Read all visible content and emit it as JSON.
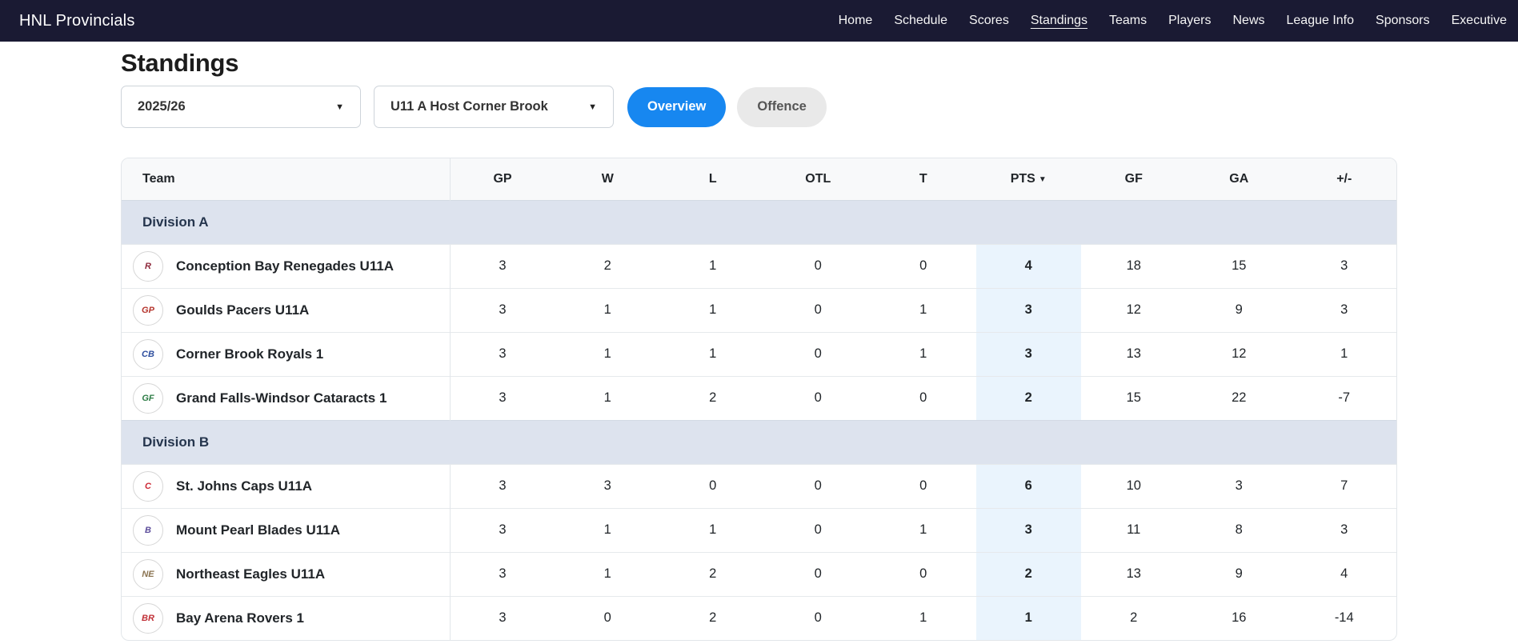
{
  "brand": "HNL Provincials",
  "nav": {
    "items": [
      {
        "label": "Home",
        "active": false
      },
      {
        "label": "Schedule",
        "active": false
      },
      {
        "label": "Scores",
        "active": false
      },
      {
        "label": "Standings",
        "active": true
      },
      {
        "label": "Teams",
        "active": false
      },
      {
        "label": "Players",
        "active": false
      },
      {
        "label": "News",
        "active": false
      },
      {
        "label": "League Info",
        "active": false
      },
      {
        "label": "Sponsors",
        "active": false
      },
      {
        "label": "Executive",
        "active": false
      }
    ]
  },
  "page_title": "Standings",
  "filters": {
    "season_value": "2025/26",
    "group_value": "U11 A Host Corner Brook"
  },
  "view_tabs": {
    "overview": "Overview",
    "offence": "Offence"
  },
  "colors": {
    "nav_bg": "#1a1a33",
    "primary": "#1787f0",
    "pts_bg": "#eaf4fd",
    "division_bg": "#dde3ee",
    "header_bg": "#f8f9fa"
  },
  "table": {
    "columns": [
      "Team",
      "GP",
      "W",
      "L",
      "OTL",
      "T",
      "PTS",
      "GF",
      "GA",
      "+/-"
    ],
    "sorted_by": "PTS",
    "sort_indicator": "▼",
    "sections": [
      {
        "name": "Division A",
        "rows": [
          {
            "team": "Conception Bay Renegades U11A",
            "logo": {
              "initials": "R",
              "color": "#8e2a3c"
            },
            "stats": {
              "gp": 3,
              "w": 2,
              "l": 1,
              "otl": 0,
              "t": 0,
              "pts": 4,
              "gf": 18,
              "ga": 15,
              "diff": 3
            }
          },
          {
            "team": "Goulds Pacers U11A",
            "logo": {
              "initials": "GP",
              "color": "#b5342c"
            },
            "stats": {
              "gp": 3,
              "w": 1,
              "l": 1,
              "otl": 0,
              "t": 1,
              "pts": 3,
              "gf": 12,
              "ga": 9,
              "diff": 3
            }
          },
          {
            "team": "Corner Brook Royals 1",
            "logo": {
              "initials": "CB",
              "color": "#2f4f9e"
            },
            "stats": {
              "gp": 3,
              "w": 1,
              "l": 1,
              "otl": 0,
              "t": 1,
              "pts": 3,
              "gf": 13,
              "ga": 12,
              "diff": 1
            }
          },
          {
            "team": "Grand Falls-Windsor Cataracts 1",
            "logo": {
              "initials": "GF",
              "color": "#2e7d46"
            },
            "stats": {
              "gp": 3,
              "w": 1,
              "l": 2,
              "otl": 0,
              "t": 0,
              "pts": 2,
              "gf": 15,
              "ga": 22,
              "diff": -7
            }
          }
        ]
      },
      {
        "name": "Division B",
        "rows": [
          {
            "team": "St. Johns Caps U11A",
            "logo": {
              "initials": "C",
              "color": "#ce2b37"
            },
            "stats": {
              "gp": 3,
              "w": 3,
              "l": 0,
              "otl": 0,
              "t": 0,
              "pts": 6,
              "gf": 10,
              "ga": 3,
              "diff": 7
            }
          },
          {
            "team": "Mount Pearl Blades U11A",
            "logo": {
              "initials": "B",
              "color": "#5c4d9b"
            },
            "stats": {
              "gp": 3,
              "w": 1,
              "l": 1,
              "otl": 0,
              "t": 1,
              "pts": 3,
              "gf": 11,
              "ga": 8,
              "diff": 3
            }
          },
          {
            "team": "Northeast Eagles U11A",
            "logo": {
              "initials": "NE",
              "color": "#8a7350"
            },
            "stats": {
              "gp": 3,
              "w": 1,
              "l": 2,
              "otl": 0,
              "t": 0,
              "pts": 2,
              "gf": 13,
              "ga": 9,
              "diff": 4
            }
          },
          {
            "team": "Bay Arena Rovers 1",
            "logo": {
              "initials": "BR",
              "color": "#c13138"
            },
            "stats": {
              "gp": 3,
              "w": 0,
              "l": 2,
              "otl": 0,
              "t": 1,
              "pts": 1,
              "gf": 2,
              "ga": 16,
              "diff": -14
            }
          }
        ]
      }
    ]
  }
}
